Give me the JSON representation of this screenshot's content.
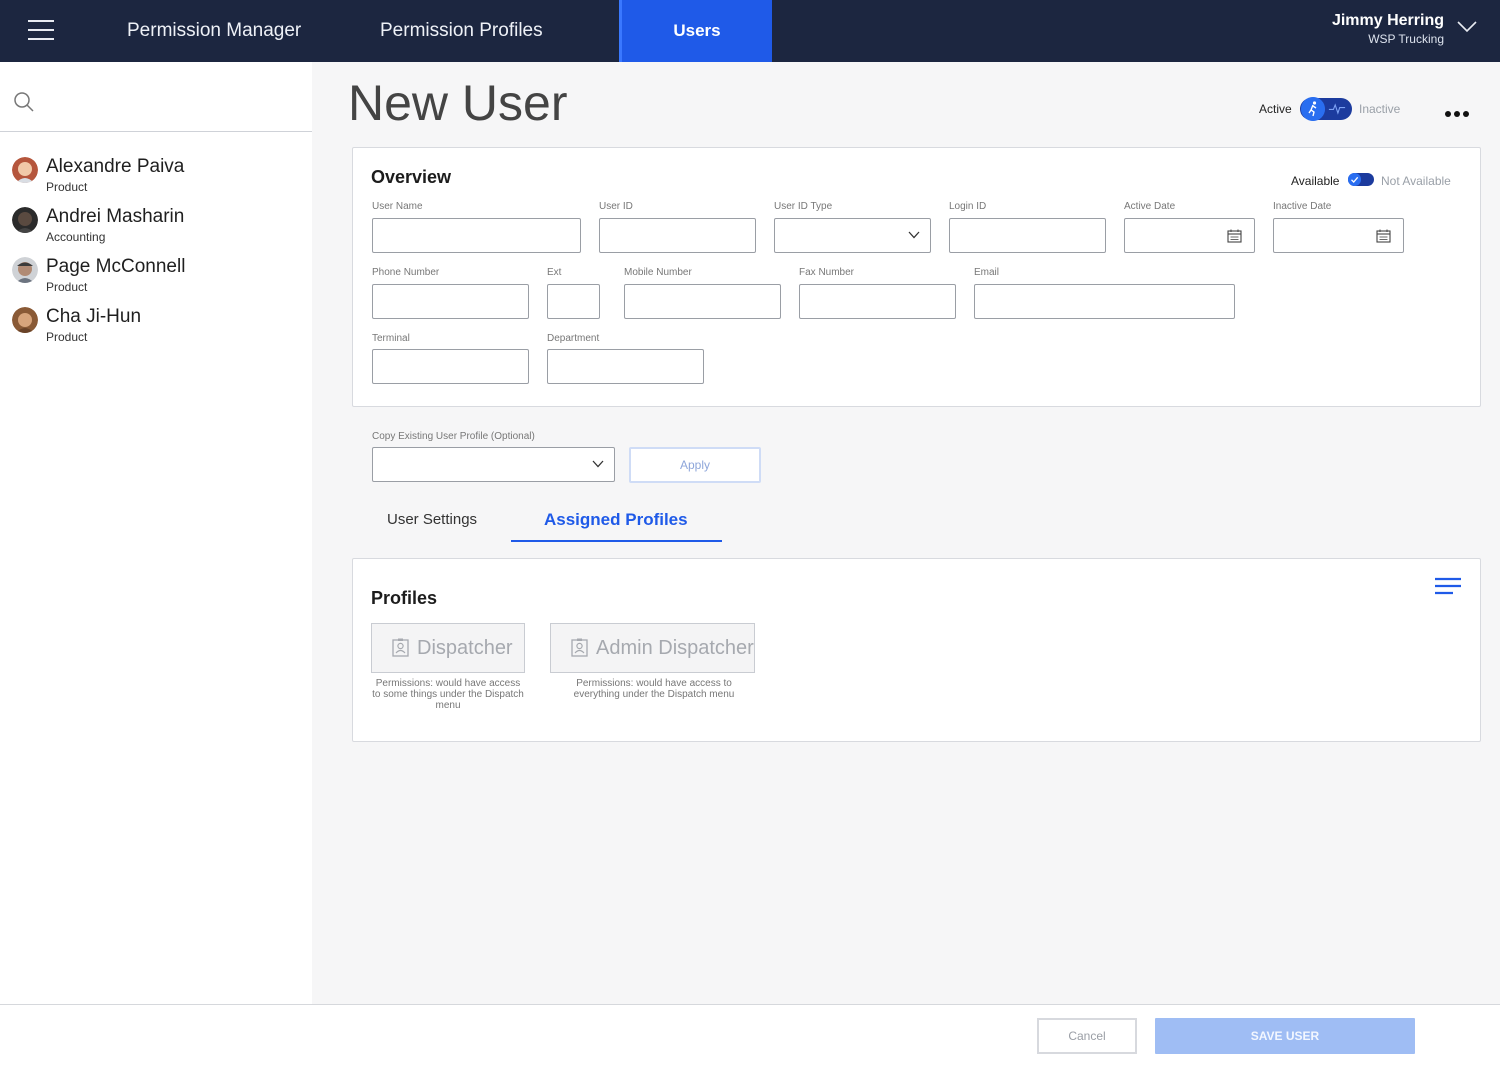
{
  "nav": {
    "items": [
      {
        "label": "Permission Manager"
      },
      {
        "label": "Permission Profiles"
      },
      {
        "label": "Users"
      }
    ],
    "active_item": "Users",
    "current_user": {
      "name": "Jimmy Herring",
      "company": "WSP Trucking"
    }
  },
  "sidebar": {
    "search_placeholder": "",
    "users": [
      {
        "name": "Alexandre Paiva",
        "department": "Product"
      },
      {
        "name": "Andrei Masharin",
        "department": "Accounting"
      },
      {
        "name": "Page McConnell",
        "department": "Product"
      },
      {
        "name": "Cha Ji-Hun",
        "department": "Product"
      }
    ]
  },
  "page": {
    "title": "New User",
    "status_active_label": "Active",
    "status_inactive_label": "Inactive",
    "status_value": "Active"
  },
  "overview": {
    "title": "Overview",
    "available_label": "Available",
    "not_available_label": "Not Available",
    "availability_value": "Available",
    "fields": {
      "user_name": "User Name",
      "user_id": "User ID",
      "user_id_type": "User ID Type",
      "login_id": "Login ID",
      "active_date": "Active Date",
      "inactive_date": "Inactive Date",
      "phone_number": "Phone Number",
      "ext": "Ext",
      "mobile_number": "Mobile Number",
      "fax_number": "Fax Number",
      "email": "Email",
      "terminal": "Terminal",
      "department": "Department"
    }
  },
  "copy_profile": {
    "label": "Copy Existing User Profile (Optional)",
    "apply_label": "Apply"
  },
  "tabs": {
    "items": [
      "User Settings",
      "Assigned Profiles"
    ],
    "active": "Assigned Profiles"
  },
  "profiles": {
    "title": "Profiles",
    "items": [
      {
        "name": "Dispatcher",
        "description": "Permissions: would have access to some things under the Dispatch menu"
      },
      {
        "name": "Admin Dispatcher",
        "description": "Permissions: would have access to everything under the Dispatch menu"
      }
    ]
  },
  "footer": {
    "cancel_label": "Cancel",
    "save_label": "SAVE USER"
  },
  "colors": {
    "nav_bg": "#1c2640",
    "accent": "#1f5ae8",
    "save_disabled": "#9fbdf4"
  }
}
